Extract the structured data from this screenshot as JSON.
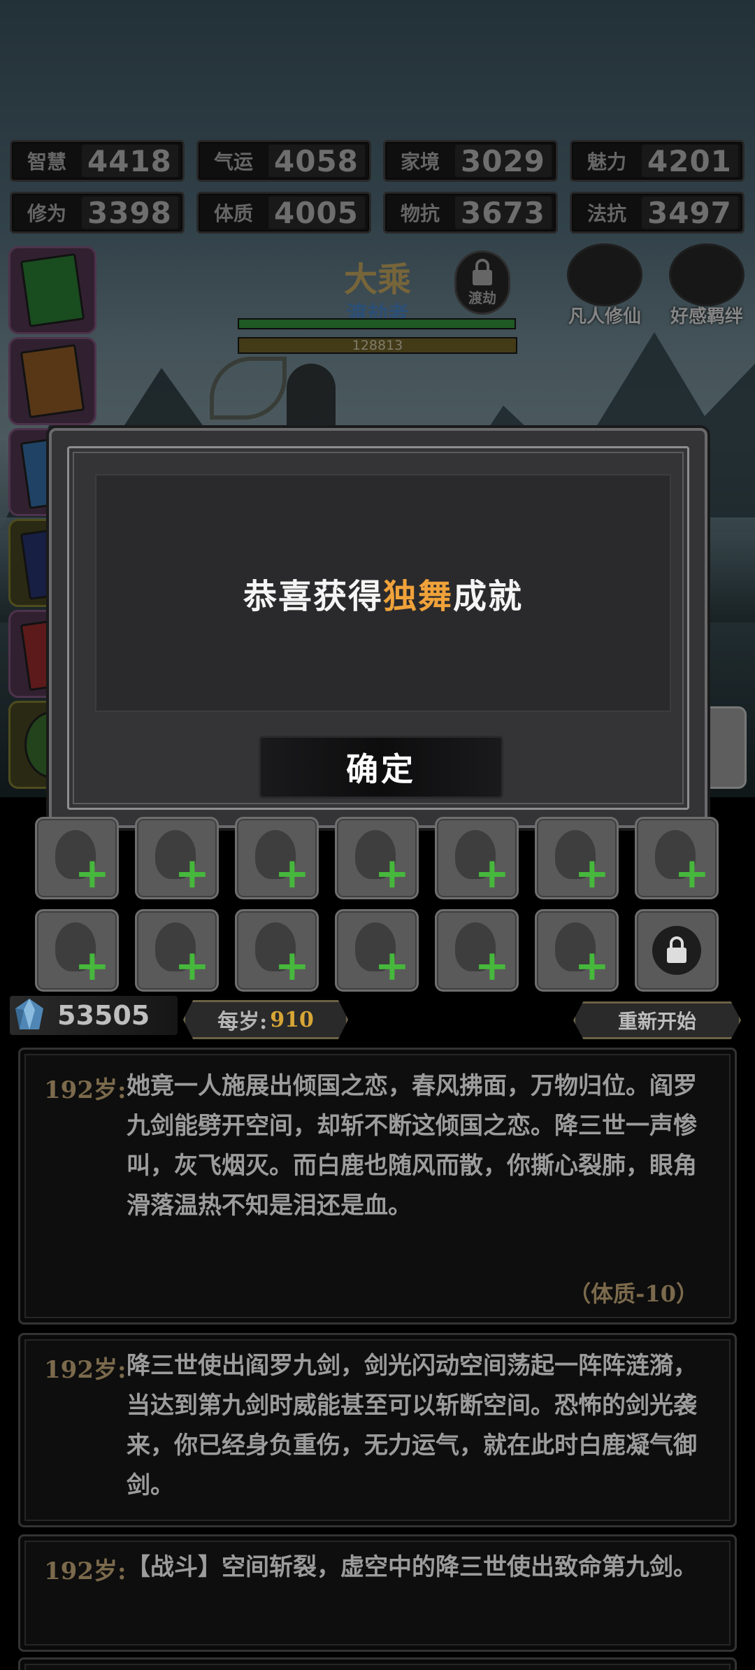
{
  "stats": [
    {
      "label": "智慧",
      "value": "4418"
    },
    {
      "label": "气运",
      "value": "4058"
    },
    {
      "label": "家境",
      "value": "3029"
    },
    {
      "label": "魅力",
      "value": "4201"
    },
    {
      "label": "修为",
      "value": "3398"
    },
    {
      "label": "体质",
      "value": "4005"
    },
    {
      "label": "物抗",
      "value": "3673"
    },
    {
      "label": "法抗",
      "value": "3497"
    }
  ],
  "realm": {
    "stage": "大乘",
    "title": "渡劫者",
    "lock_label": "渡劫",
    "exp_value": "128813"
  },
  "top_buttons": {
    "mortal": "凡人修仙",
    "affection": "好感羁绊"
  },
  "dialog": {
    "msg_before": "恭喜获得",
    "msg_highlight": "独舞",
    "msg_after": "成就",
    "confirm_label": "确定"
  },
  "currency": {
    "amount": "53505",
    "per_year_label": "每岁:",
    "per_year_value": "910",
    "restart_label": "重新开始"
  },
  "log": [
    {
      "age": "192岁:",
      "text": "她竟一人施展出倾国之恋，春风拂面，万物归位。阎罗九剑能劈开空间，却斩不断这倾国之恋。降三世一声惨叫，灰飞烟灭。而白鹿也随风而散，你撕心裂肺，眼角滑落温热不知是泪还是血。",
      "effect": "（体质-10）"
    },
    {
      "age": "192岁:",
      "text": "降三世使出阎罗九剑，剑光闪动空间荡起一阵阵涟漪，当达到第九剑时威能甚至可以斩断空间。恐怖的剑光袭来，你已经身负重伤，无力运气，就在此时白鹿凝气御剑。"
    },
    {
      "age": "192岁:",
      "text": "【战斗】空间斩裂，虚空中的降三世使出致命第九剑。"
    }
  ],
  "colors": {
    "highlight": "#f0a23a",
    "plus_green": "#46b83c",
    "gold": "#d8a636"
  }
}
